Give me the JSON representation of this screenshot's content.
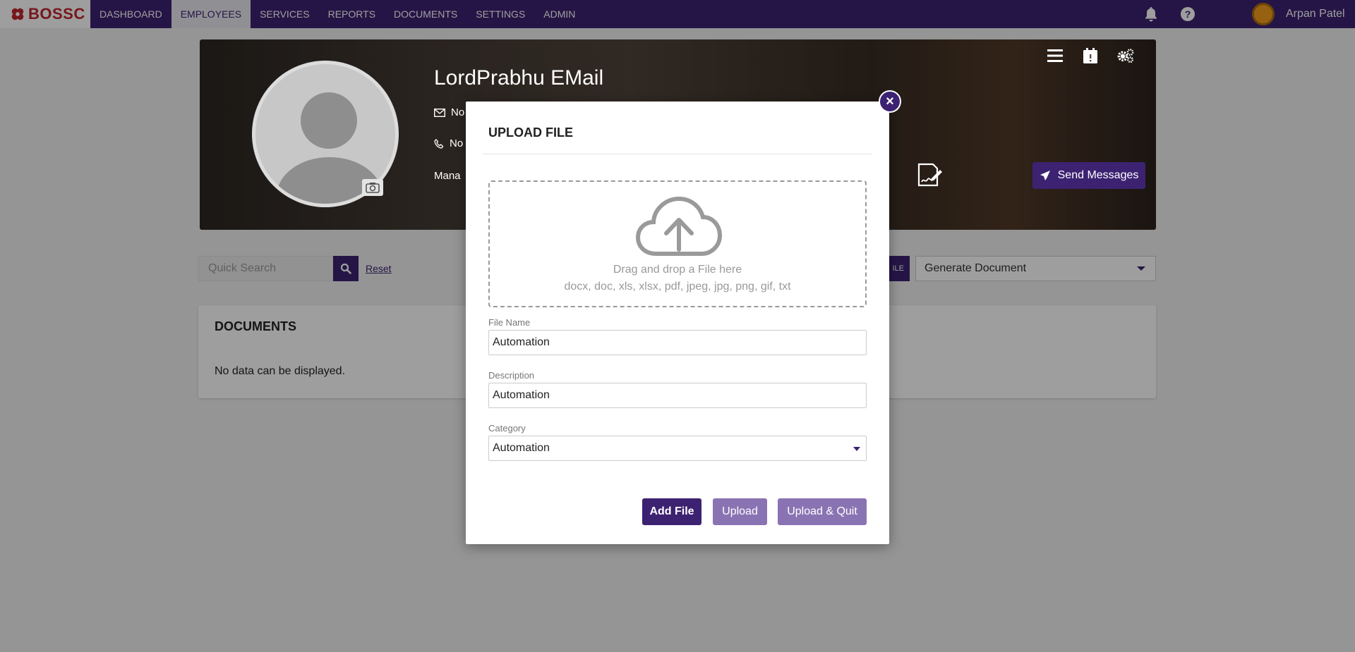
{
  "brand": {
    "logo_text": "BOSSC",
    "logo_color": "#c0262e"
  },
  "nav": {
    "items": [
      {
        "label": "DASHBOARD"
      },
      {
        "label": "EMPLOYEES",
        "active": true
      },
      {
        "label": "SERVICES"
      },
      {
        "label": "REPORTS"
      },
      {
        "label": "DOCUMENTS"
      },
      {
        "label": "SETTINGS"
      },
      {
        "label": "ADMIN"
      }
    ],
    "user_name": "Arpan Patel",
    "icons": [
      "bell-icon",
      "help-icon"
    ]
  },
  "profile": {
    "name": "LordPrabhu EMail",
    "email_fragment": "No",
    "phone_fragment": "No",
    "manager_fragment": "Mana",
    "send_messages_label": "Send Messages",
    "tool_icons": [
      "list-icon",
      "calendar-icon",
      "gears-icon"
    ]
  },
  "toolbar": {
    "search_placeholder": "Quick Search",
    "reset_label": "Reset",
    "file_button_fragment": "ILE",
    "generate_document_label": "Generate Document"
  },
  "documents": {
    "title": "DOCUMENTS",
    "empty_text": "No data can be displayed."
  },
  "modal": {
    "title": "UPLOAD FILE",
    "close_label": "×",
    "drop_text": "Drag and drop a File here",
    "allowed_types": "docx, doc, xls, xlsx, pdf, jpeg, jpg, png, gif, txt",
    "file_name_label": "File Name",
    "file_name_value": "Automation",
    "description_label": "Description",
    "description_value": "Automation",
    "category_label": "Category",
    "category_value": "Automation",
    "add_file_label": "Add File",
    "upload_label": "Upload",
    "upload_quit_label": "Upload & Quit"
  },
  "colors": {
    "primary": "#3d2272",
    "secondary_button": "#8a73b3",
    "avatar": "#f39f1c"
  }
}
